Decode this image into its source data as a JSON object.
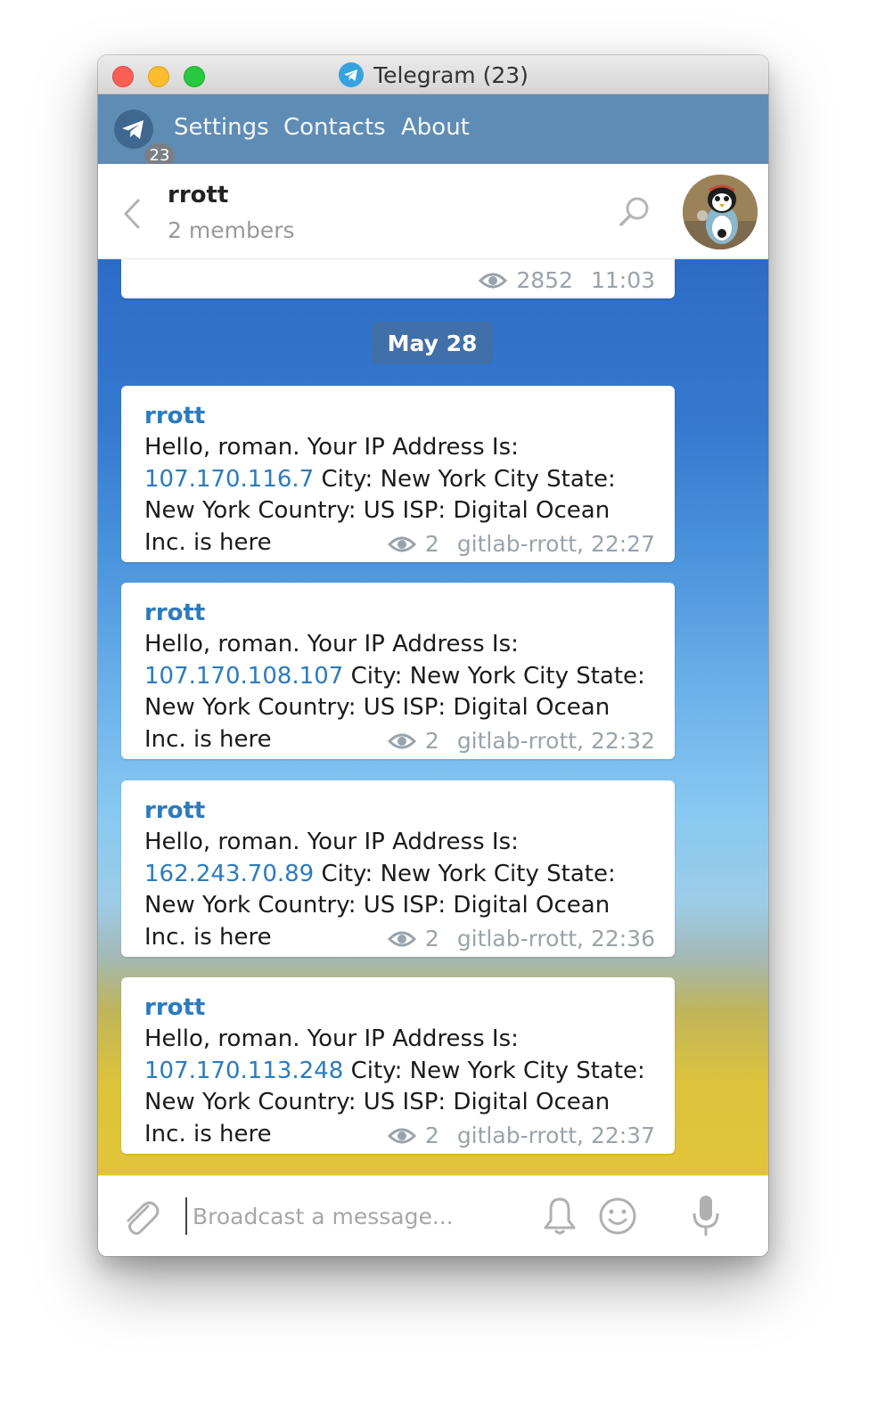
{
  "window": {
    "title": "Telegram (23)"
  },
  "menubar": {
    "badge": "23",
    "items": [
      {
        "label": "Settings"
      },
      {
        "label": "Contacts"
      },
      {
        "label": "About"
      }
    ]
  },
  "chat": {
    "name": "rrott",
    "subtitle": "2 members"
  },
  "top_message": {
    "views": "2852",
    "time": "11:03"
  },
  "date_separator": "May 28",
  "messages": [
    {
      "sender": "rrott",
      "text_before": "Hello, roman. Your IP Address Is: ",
      "ip": "107.170.116.7",
      "text_after": " City: New York City State: New York Country: US ISP: Digital Ocean Inc. is here",
      "views": "2",
      "meta": "gitlab-rrott, 22:27"
    },
    {
      "sender": "rrott",
      "text_before": "Hello, roman. Your IP Address Is: ",
      "ip": "107.170.108.107",
      "text_after": " City: New York City State: New York Country: US ISP: Digital Ocean Inc. is here",
      "views": "2",
      "meta": "gitlab-rrott, 22:32"
    },
    {
      "sender": "rrott",
      "text_before": "Hello, roman. Your IP Address Is: ",
      "ip": "162.243.70.89",
      "text_after": " City: New York City State: New York Country: US ISP: Digital Ocean Inc. is here",
      "views": "2",
      "meta": "gitlab-rrott, 22:36"
    },
    {
      "sender": "rrott",
      "text_before": "Hello, roman. Your IP Address Is: ",
      "ip": "107.170.113.248",
      "text_after": " City: New York City State: New York Country: US ISP: Digital Ocean Inc. is here",
      "views": "2",
      "meta": "gitlab-rrott, 22:37"
    }
  ],
  "composer": {
    "placeholder": "Broadcast a message..."
  },
  "icons": {
    "telegram": "telegram-plane-icon",
    "back": "chevron-left-icon",
    "search": "search-icon",
    "views": "eye-icon",
    "attach": "paperclip-icon",
    "bell": "bell-icon",
    "emoji": "smile-icon",
    "mic": "microphone-icon"
  },
  "colors": {
    "menubar": "#5f8cb5",
    "link": "#2c7bbd",
    "date_pill": "#466ea0"
  }
}
